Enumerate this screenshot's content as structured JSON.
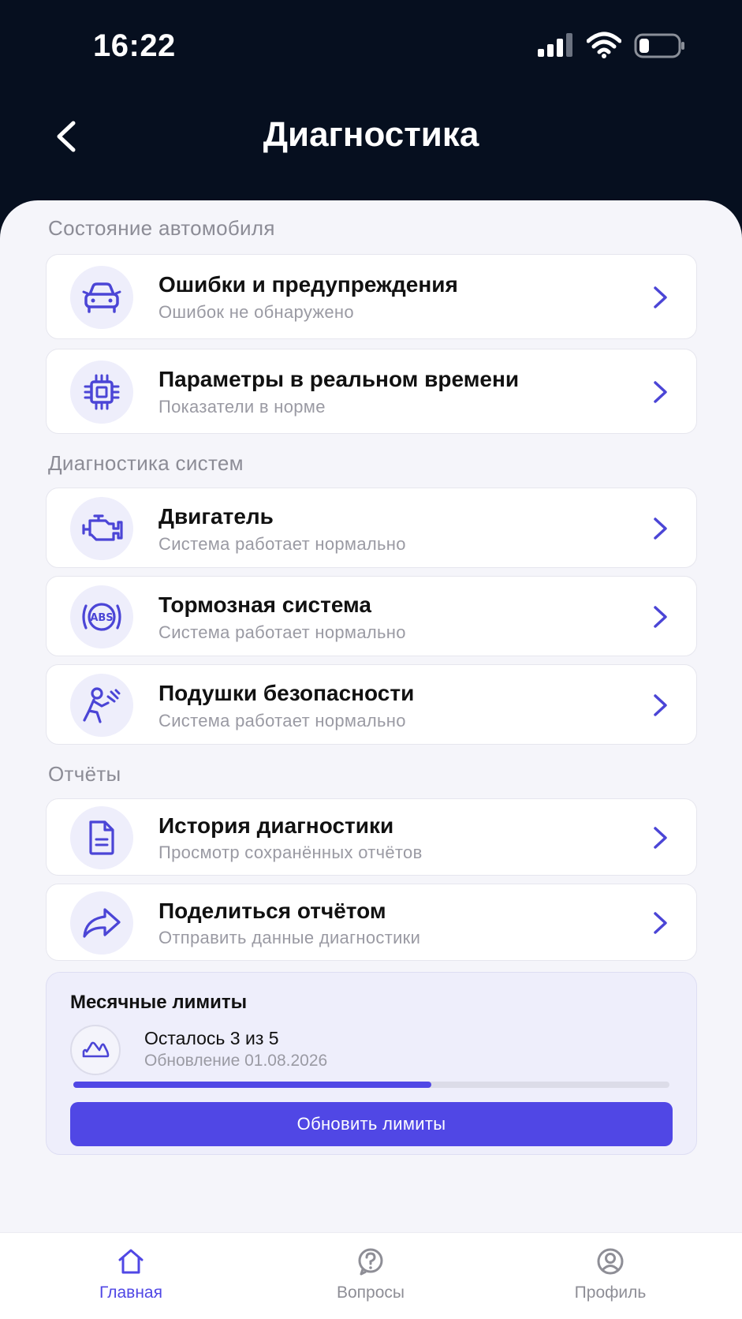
{
  "status_bar": {
    "time": "16:22",
    "icons": [
      "signal-icon",
      "wifi-icon",
      "battery-icon"
    ]
  },
  "header": {
    "title": "Диагностика",
    "back_icon": "chevron-left-icon"
  },
  "sections": {
    "vehicle_state": "Состояние автомобиля",
    "systems": "Диагностика систем",
    "reports": "Отчёты"
  },
  "items": {
    "errors": {
      "title": "Ошибки и предупреждения",
      "subtitle": "Ошибок не обнаружено",
      "icon": "car-icon"
    },
    "realtime": {
      "title": "Параметры в реальном времени",
      "subtitle": "Показатели в норме",
      "icon": "chip-icon"
    },
    "engine": {
      "title": "Двигатель",
      "subtitle": "Система работает нормально",
      "icon": "engine-icon"
    },
    "brakes": {
      "title": "Тормозная система",
      "subtitle": "Система работает нормально",
      "icon": "abs-icon"
    },
    "airbags": {
      "title": "Подушки безопасности",
      "subtitle": "Система работает нормально",
      "icon": "airbag-icon"
    },
    "history": {
      "title": "История диагностики",
      "subtitle": "Просмотр сохранённых отчётов",
      "icon": "document-icon"
    },
    "share": {
      "title": "Поделиться отчётом",
      "subtitle": "Отправить данные диагностики",
      "icon": "share-icon"
    }
  },
  "limits": {
    "title": "Месячные лимиты",
    "remaining": "Осталось 3 из 5",
    "update": "Обновление 01.08.2026",
    "progress_fraction": 0.6,
    "button_label": "Обновить лимиты",
    "icon": "cloud-icon"
  },
  "tabbar": {
    "home": "Главная",
    "questions": "Вопросы",
    "profile": "Профиль",
    "active": "home"
  },
  "colors": {
    "accent": "#5047e5",
    "header_bg": "#060f1f",
    "sheet_bg": "#f5f5fa",
    "icon_bg": "#eeeefb"
  }
}
